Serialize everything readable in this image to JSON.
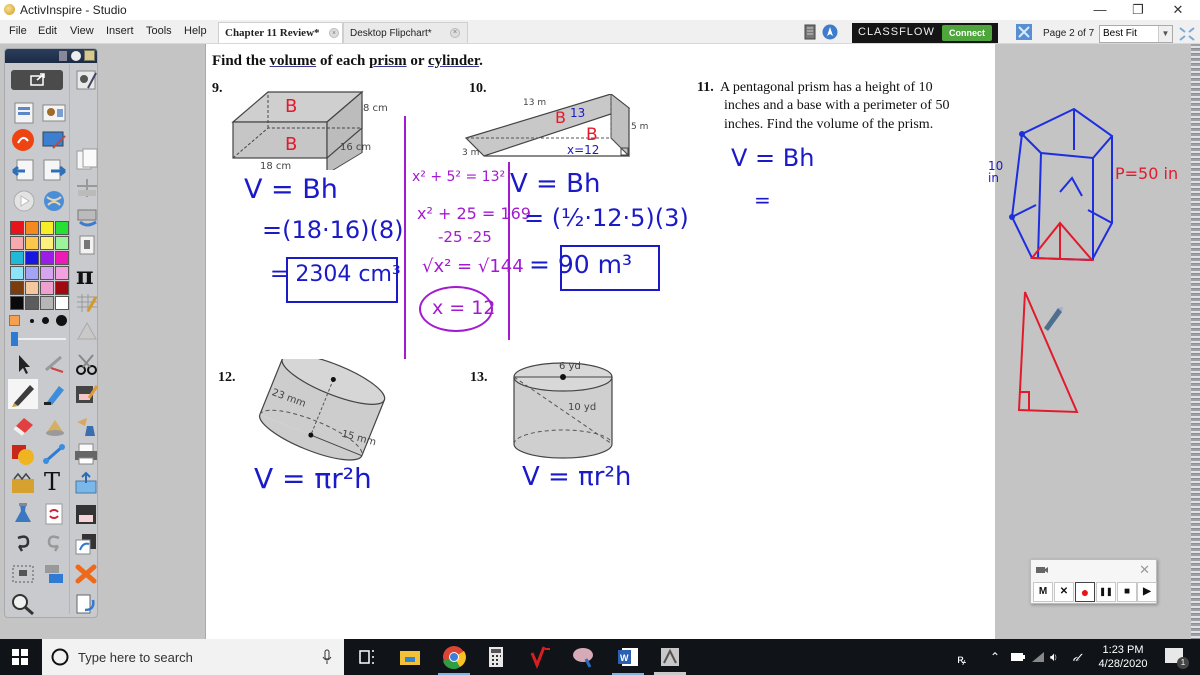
{
  "window": {
    "title": "ActivInspire - Studio",
    "controls": {
      "minimize": "—",
      "restore": "❐",
      "close": "✕"
    }
  },
  "menubar": {
    "menus": [
      "File",
      "Edit",
      "View",
      "Insert",
      "Tools",
      "Help"
    ],
    "tabs": [
      {
        "label": "Chapter 11 Review*",
        "active": true
      },
      {
        "label": "Desktop Flipchart*",
        "active": false
      }
    ],
    "classflow": {
      "label": "CLASSFLOW",
      "connect_label": "Connect"
    },
    "page_indicator": "Page 2 of 7",
    "zoom_value": "Best Fit"
  },
  "toolbox": {
    "colors": [
      "#e8141b",
      "#f4891e",
      "#f7ef25",
      "#25e232",
      "#f7a9b0",
      "#fbc84d",
      "#fbf17c",
      "#9df29c",
      "#22b9d9",
      "#1717e0",
      "#9c1de8",
      "#ee1ab5",
      "#8fe3f7",
      "#a3a4f4",
      "#d7a4f0",
      "#f2a2de",
      "#7a3e0e",
      "#f4c79c",
      "#f0a0cf",
      "#a00a0f",
      "#0a0a0a",
      "#5c5c5c",
      "#b6b6b6",
      "#ffffff"
    ],
    "tools": [
      "share-icon",
      "resource-browser-icon",
      "page-browser-icon",
      "property-browser-icon",
      "pen-dial-icon",
      "screen-recorder-icon",
      "previous-page-icon",
      "next-page-icon",
      "play-icon",
      "globe-icon",
      "pointer-icon",
      "marquee-icon",
      "pen-icon",
      "highlighter-icon",
      "eraser-icon",
      "fill-icon",
      "shape-icon",
      "connector-icon",
      "clipart-icon",
      "text-icon",
      "clear-icon",
      "reset-page-icon",
      "undo-icon",
      "redo-icon",
      "camera-icon",
      "spotlight-icon",
      "magnifier-icon",
      "scissors-icon",
      "save-icon",
      "magic-ink-icon",
      "print-icon",
      "export-icon",
      "floppy-icon",
      "desktop-annotate-icon",
      "delete-icon",
      "clipboard-icon",
      "calculator-icon",
      "pi-icon",
      "protractor-icon"
    ]
  },
  "worksheet": {
    "heading_parts": [
      "Find the ",
      "volume",
      " of each ",
      "prism",
      " or ",
      "cylinder",
      "."
    ],
    "problems": {
      "p9": {
        "number": "9.",
        "labels": {
          "height": "8 cm",
          "width": "16 cm",
          "length": "18 cm"
        },
        "annotations": {
          "base_top": "B",
          "base_front": "B"
        },
        "work": [
          "V = Bh",
          "=(18·16)(8)",
          "= 2304 cm³"
        ]
      },
      "p10": {
        "number": "10.",
        "labels": {
          "hyp": "13 m",
          "height": "5 m",
          "depth": "3 m"
        },
        "annotations": {
          "b1": "B",
          "n13": "13",
          "b2": "B",
          "x": "x=12"
        },
        "side_work": [
          "x² + 5² = 13²",
          "x² + 25 = 169",
          "-25  -25",
          "√x² = √144",
          "x = 12"
        ],
        "work": [
          "V = Bh",
          "= (½·12·5)(3)",
          "= 90 m³"
        ]
      },
      "p11": {
        "number": "11.",
        "text_lines": [
          "A pentagonal prism has a height of 10",
          "inches and a base with a perimeter of 50",
          "inches.  Find the volume of the prism."
        ],
        "work": [
          "V = Bh",
          "="
        ],
        "sketch_labels": {
          "height": "10 in",
          "perimeter": "P=50 in"
        }
      },
      "p12": {
        "number": "12.",
        "labels": {
          "height": "23 mm",
          "radius": "15 mm"
        },
        "work": "V = πr²h"
      },
      "p13": {
        "number": "13.",
        "labels": {
          "diameter": "6 yd",
          "diagonal": "10 yd"
        },
        "work": "V = πr²h"
      }
    }
  },
  "recorder": {
    "buttons": [
      "M",
      "✕",
      "●",
      "❚❚",
      "■",
      "▶"
    ]
  },
  "taskbar": {
    "search_placeholder": "Type here to search",
    "apps": [
      "task-view-icon",
      "file-explorer-icon",
      "chrome-icon",
      "calculator-icon",
      "mathtype-icon",
      "paint-icon",
      "word-icon",
      "activinspire-icon"
    ],
    "time": "1:23 PM",
    "date": "4/28/2020",
    "notification_count": "1"
  }
}
